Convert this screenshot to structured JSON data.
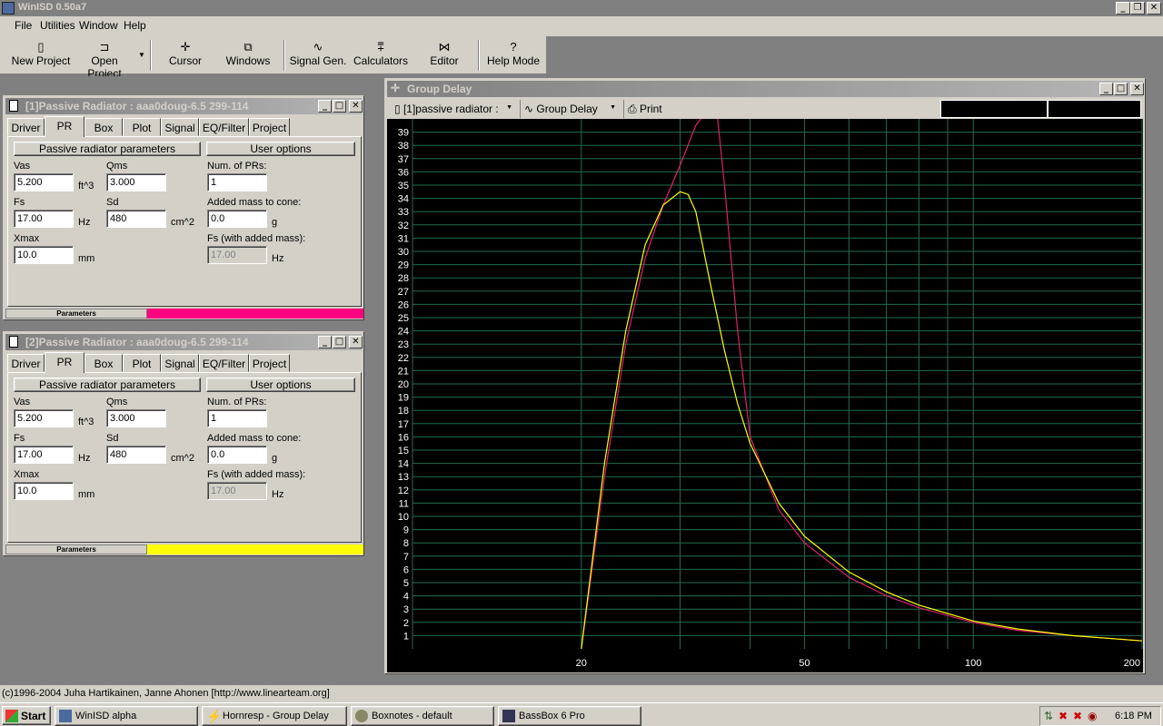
{
  "app": {
    "title": "WinISD 0.50a7"
  },
  "menu": [
    "File",
    "Utilities",
    "Window",
    "Help"
  ],
  "toolbar": [
    "New Project",
    "Open Project",
    "Cursor",
    "Windows",
    "Signal Gen.",
    "Calculators",
    "Editor",
    "Help Mode"
  ],
  "pr1": {
    "title": "[1]Passive Radiator : aaa0doug-6.5 299-114",
    "statusbar_label": "Parameters",
    "statusbar_color": "#ff0080",
    "vas": "5.200",
    "qms": "3.000",
    "num_prs": "1",
    "fs": "17.00",
    "sd": "480",
    "added_mass": "0.0",
    "xmax": "10.0",
    "fs_added": "17.00"
  },
  "pr2": {
    "title": "[2]Passive Radiator : aaa0doug-6.5 299-114",
    "statusbar_label": "Parameters",
    "statusbar_color": "#ffff00",
    "vas": "5.200",
    "qms": "3.000",
    "num_prs": "1",
    "fs": "17.00",
    "sd": "480",
    "added_mass": "0.0",
    "xmax": "10.0",
    "fs_added": "17.00"
  },
  "tabs": [
    "Driver",
    "PR",
    "Box",
    "Plot",
    "Signal",
    "EQ/Filter",
    "Project"
  ],
  "form": {
    "group_params": "Passive radiator parameters",
    "group_user": "User options",
    "vas_label": "Vas",
    "vas_unit": "ft^3",
    "qms_label": "Qms",
    "num_prs_label": "Num. of PRs:",
    "fs_label": "Fs",
    "fs_unit": "Hz",
    "sd_label": "Sd",
    "sd_unit": "cm^2",
    "added_mass_label": "Added mass to cone:",
    "added_mass_unit": "g",
    "xmax_label": "Xmax",
    "xmax_unit": "mm",
    "fs_added_label": "Fs (with added mass):",
    "fs_added_unit": "Hz"
  },
  "graph": {
    "title": "Group Delay",
    "project_select": "[1]passive radiator :",
    "plot_select": "Group Delay",
    "print_label": "Print"
  },
  "chart_data": {
    "type": "line",
    "title": "",
    "xlabel": "",
    "ylabel": "",
    "x_scale": "log",
    "xlim": [
      10,
      200
    ],
    "ylim": [
      0,
      40
    ],
    "x_ticks": [
      "20",
      "50",
      "100",
      "200"
    ],
    "y_ticks": [
      "1",
      "2",
      "3",
      "4",
      "5",
      "6",
      "7",
      "8",
      "9",
      "10",
      "11",
      "12",
      "13",
      "14",
      "15",
      "16",
      "17",
      "18",
      "19",
      "20",
      "21",
      "22",
      "23",
      "24",
      "25",
      "26",
      "27",
      "28",
      "29",
      "30",
      "31",
      "32",
      "33",
      "34",
      "35",
      "36",
      "37",
      "38",
      "39"
    ],
    "grid": true,
    "series": [
      {
        "color": "#ffff00",
        "x": [
          20,
          22,
          24,
          26,
          28,
          30,
          31,
          32,
          34,
          36,
          38,
          40,
          45,
          50,
          60,
          70,
          80,
          100,
          120,
          150,
          200
        ],
        "y": [
          0,
          14,
          24,
          30.5,
          33.5,
          34.5,
          34.3,
          33,
          27.5,
          22.5,
          18.5,
          15.5,
          11,
          8.5,
          5.8,
          4.3,
          3.3,
          2.1,
          1.5,
          1.0,
          0.6
        ]
      },
      {
        "color": "#e0206a",
        "x": [
          20,
          22,
          24,
          26,
          28,
          30,
          32,
          34,
          35,
          36,
          38,
          40,
          45,
          50,
          60,
          70,
          80,
          100,
          120,
          150,
          200
        ],
        "y": [
          0,
          13,
          23,
          29.5,
          33.5,
          36.5,
          39.5,
          41,
          40,
          35,
          24,
          16,
          10.5,
          8,
          5.4,
          4.0,
          3.1,
          2.0,
          1.4,
          1.0,
          0.6
        ]
      }
    ]
  },
  "status": {
    "copyright": "(c)1996-2004 Juha Hartikainen, Janne Ahonen [http://www.linearteam.org]"
  },
  "taskbar": {
    "start": "Start",
    "items": [
      "WinISD alpha",
      "Hornresp - Group Delay",
      "Boxnotes - default",
      "BassBox 6 Pro"
    ],
    "clock": "6:18 PM"
  }
}
